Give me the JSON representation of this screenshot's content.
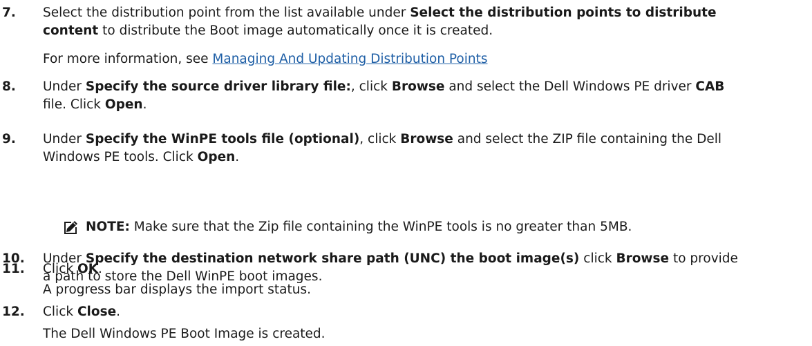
{
  "steps": [
    {
      "number": "7.",
      "lines": [
        [
          "Select the distribution point from the list available under ",
          {
            "b": "Select the distribution points to distribute"
          }
        ],
        [
          {
            "b": "content"
          },
          " to distribute the Boot image automatically once it is created."
        ]
      ],
      "extra": {
        "prefix": "For more information, see ",
        "link": "Managing And Updating Distribution Points"
      }
    },
    {
      "number": "8.",
      "lines": [
        [
          "Under ",
          {
            "b": "Specify the source driver library file:"
          },
          ", click ",
          {
            "b": "Browse"
          },
          " and select the Dell Windows PE driver ",
          {
            "b": "CAB"
          }
        ],
        [
          "file. Click ",
          {
            "b": "Open"
          },
          "."
        ]
      ]
    },
    {
      "number": "9.",
      "lines": [
        [
          "Under ",
          {
            "b": "Specify the WinPE tools file (optional)"
          },
          ", click ",
          {
            "b": "Browse"
          },
          " and select the ZIP file containing the Dell"
        ],
        [
          "Windows PE tools. Click ",
          {
            "b": "Open"
          },
          "."
        ]
      ]
    },
    {
      "number": "10.",
      "lines": [
        [
          "Under ",
          {
            "b": "Specify the destination network share path (UNC) the boot image(s)"
          },
          " click ",
          {
            "b": "Browse"
          },
          " to provide"
        ],
        [
          "a path to store the Dell WinPE boot images."
        ]
      ]
    },
    {
      "number": "11.",
      "lines": [
        [
          "Click ",
          {
            "b": "OK"
          },
          "."
        ]
      ],
      "sub": "A progress bar displays the import status."
    },
    {
      "number": "12.",
      "lines": [
        [
          "Click ",
          {
            "b": "Close"
          },
          "."
        ]
      ],
      "sub": "The Dell Windows PE Boot Image is created."
    }
  ],
  "note": {
    "icon": "pencil-note-icon",
    "label": "NOTE:",
    "text": " Make sure that the Zip file containing the WinPE tools is no greater than 5MB."
  },
  "colors": {
    "text": "#1a1a1a",
    "link": "#1f5fa6"
  }
}
